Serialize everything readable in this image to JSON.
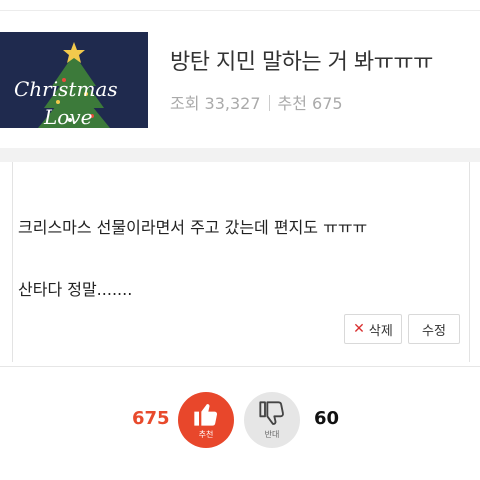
{
  "post": {
    "title": "방탄 지민 말하는 거 봐ㅠㅠㅠ",
    "views_label": "조회 33,327",
    "recommend_label": "추천 675"
  },
  "thumbnail": {
    "word1": "Christmas",
    "word2": "Love",
    "icon": "christmas-tree"
  },
  "body": {
    "paragraphs": [
      "크리스마스 선물이라면서 주고 갔는데 편지도 ㅠㅠㅠ",
      "산타다 정말......."
    ]
  },
  "actions": {
    "delete_label": "삭제",
    "edit_label": "수정"
  },
  "votes": {
    "up_count": "675",
    "up_label": "추천",
    "down_count": "60",
    "down_label": "반대"
  },
  "colors": {
    "accent": "#e8472b",
    "thumbnail_bg": "#1f2a4e"
  }
}
